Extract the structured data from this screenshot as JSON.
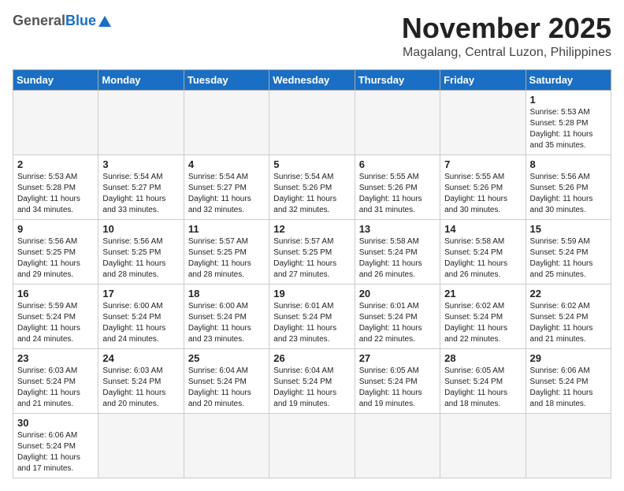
{
  "header": {
    "logo_general": "General",
    "logo_blue": "Blue",
    "month_title": "November 2025",
    "location": "Magalang, Central Luzon, Philippines"
  },
  "weekdays": [
    "Sunday",
    "Monday",
    "Tuesday",
    "Wednesday",
    "Thursday",
    "Friday",
    "Saturday"
  ],
  "weeks": [
    [
      {
        "day": "",
        "info": ""
      },
      {
        "day": "",
        "info": ""
      },
      {
        "day": "",
        "info": ""
      },
      {
        "day": "",
        "info": ""
      },
      {
        "day": "",
        "info": ""
      },
      {
        "day": "",
        "info": ""
      },
      {
        "day": "1",
        "info": "Sunrise: 5:53 AM\nSunset: 5:28 PM\nDaylight: 11 hours\nand 35 minutes."
      }
    ],
    [
      {
        "day": "2",
        "info": "Sunrise: 5:53 AM\nSunset: 5:28 PM\nDaylight: 11 hours\nand 34 minutes."
      },
      {
        "day": "3",
        "info": "Sunrise: 5:54 AM\nSunset: 5:27 PM\nDaylight: 11 hours\nand 33 minutes."
      },
      {
        "day": "4",
        "info": "Sunrise: 5:54 AM\nSunset: 5:27 PM\nDaylight: 11 hours\nand 32 minutes."
      },
      {
        "day": "5",
        "info": "Sunrise: 5:54 AM\nSunset: 5:26 PM\nDaylight: 11 hours\nand 32 minutes."
      },
      {
        "day": "6",
        "info": "Sunrise: 5:55 AM\nSunset: 5:26 PM\nDaylight: 11 hours\nand 31 minutes."
      },
      {
        "day": "7",
        "info": "Sunrise: 5:55 AM\nSunset: 5:26 PM\nDaylight: 11 hours\nand 30 minutes."
      },
      {
        "day": "8",
        "info": "Sunrise: 5:56 AM\nSunset: 5:26 PM\nDaylight: 11 hours\nand 30 minutes."
      }
    ],
    [
      {
        "day": "9",
        "info": "Sunrise: 5:56 AM\nSunset: 5:25 PM\nDaylight: 11 hours\nand 29 minutes."
      },
      {
        "day": "10",
        "info": "Sunrise: 5:56 AM\nSunset: 5:25 PM\nDaylight: 11 hours\nand 28 minutes."
      },
      {
        "day": "11",
        "info": "Sunrise: 5:57 AM\nSunset: 5:25 PM\nDaylight: 11 hours\nand 28 minutes."
      },
      {
        "day": "12",
        "info": "Sunrise: 5:57 AM\nSunset: 5:25 PM\nDaylight: 11 hours\nand 27 minutes."
      },
      {
        "day": "13",
        "info": "Sunrise: 5:58 AM\nSunset: 5:24 PM\nDaylight: 11 hours\nand 26 minutes."
      },
      {
        "day": "14",
        "info": "Sunrise: 5:58 AM\nSunset: 5:24 PM\nDaylight: 11 hours\nand 26 minutes."
      },
      {
        "day": "15",
        "info": "Sunrise: 5:59 AM\nSunset: 5:24 PM\nDaylight: 11 hours\nand 25 minutes."
      }
    ],
    [
      {
        "day": "16",
        "info": "Sunrise: 5:59 AM\nSunset: 5:24 PM\nDaylight: 11 hours\nand 24 minutes."
      },
      {
        "day": "17",
        "info": "Sunrise: 6:00 AM\nSunset: 5:24 PM\nDaylight: 11 hours\nand 24 minutes."
      },
      {
        "day": "18",
        "info": "Sunrise: 6:00 AM\nSunset: 5:24 PM\nDaylight: 11 hours\nand 23 minutes."
      },
      {
        "day": "19",
        "info": "Sunrise: 6:01 AM\nSunset: 5:24 PM\nDaylight: 11 hours\nand 23 minutes."
      },
      {
        "day": "20",
        "info": "Sunrise: 6:01 AM\nSunset: 5:24 PM\nDaylight: 11 hours\nand 22 minutes."
      },
      {
        "day": "21",
        "info": "Sunrise: 6:02 AM\nSunset: 5:24 PM\nDaylight: 11 hours\nand 22 minutes."
      },
      {
        "day": "22",
        "info": "Sunrise: 6:02 AM\nSunset: 5:24 PM\nDaylight: 11 hours\nand 21 minutes."
      }
    ],
    [
      {
        "day": "23",
        "info": "Sunrise: 6:03 AM\nSunset: 5:24 PM\nDaylight: 11 hours\nand 21 minutes."
      },
      {
        "day": "24",
        "info": "Sunrise: 6:03 AM\nSunset: 5:24 PM\nDaylight: 11 hours\nand 20 minutes."
      },
      {
        "day": "25",
        "info": "Sunrise: 6:04 AM\nSunset: 5:24 PM\nDaylight: 11 hours\nand 20 minutes."
      },
      {
        "day": "26",
        "info": "Sunrise: 6:04 AM\nSunset: 5:24 PM\nDaylight: 11 hours\nand 19 minutes."
      },
      {
        "day": "27",
        "info": "Sunrise: 6:05 AM\nSunset: 5:24 PM\nDaylight: 11 hours\nand 19 minutes."
      },
      {
        "day": "28",
        "info": "Sunrise: 6:05 AM\nSunset: 5:24 PM\nDaylight: 11 hours\nand 18 minutes."
      },
      {
        "day": "29",
        "info": "Sunrise: 6:06 AM\nSunset: 5:24 PM\nDaylight: 11 hours\nand 18 minutes."
      }
    ],
    [
      {
        "day": "30",
        "info": "Sunrise: 6:06 AM\nSunset: 5:24 PM\nDaylight: 11 hours\nand 17 minutes."
      },
      {
        "day": "",
        "info": ""
      },
      {
        "day": "",
        "info": ""
      },
      {
        "day": "",
        "info": ""
      },
      {
        "day": "",
        "info": ""
      },
      {
        "day": "",
        "info": ""
      },
      {
        "day": "",
        "info": ""
      }
    ]
  ]
}
